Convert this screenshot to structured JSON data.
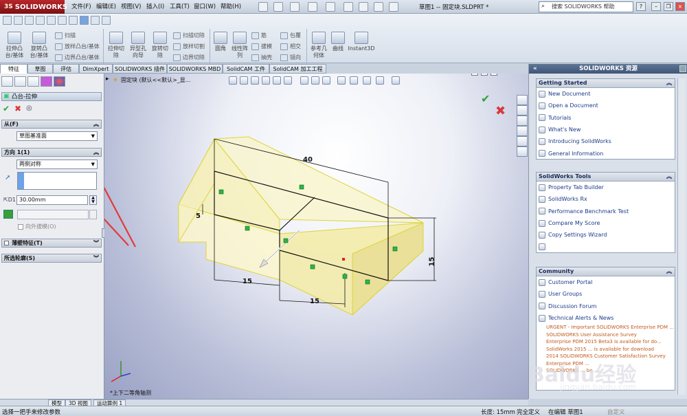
{
  "app": {
    "logo": "SOLIDWORKS",
    "logo_prefix": "3S",
    "title": "草图1 -- 固定块.SLDPRT *"
  },
  "menu": [
    "文件(F)",
    "编辑(E)",
    "视图(V)",
    "插入(I)",
    "工具(T)",
    "窗口(W)",
    "帮助(H)"
  ],
  "help_search": {
    "placeholder": "搜索 SOLIDWORKS 帮助"
  },
  "ribbon": {
    "big": [
      {
        "id": "extrude-boss",
        "label": "拉伸凸台/基体"
      },
      {
        "id": "revolve-boss",
        "label": "旋转凸台/基体"
      },
      {
        "id": "extrude-cut",
        "label": "拉伸切除"
      },
      {
        "id": "hole-wizard",
        "label": "异型孔向导"
      },
      {
        "id": "revolve-cut",
        "label": "旋转切除"
      },
      {
        "id": "fillet",
        "label": "圆角"
      },
      {
        "id": "linear-pattern",
        "label": "线性阵列"
      },
      {
        "id": "ref-geometry",
        "label": "参考几何体"
      },
      {
        "id": "curves",
        "label": "曲线"
      },
      {
        "id": "instant3d",
        "label": "Instant3D"
      }
    ],
    "small": {
      "sweep": "扫描",
      "loft": "放样凸台/基体",
      "boundary": "边界凸台/基体",
      "sweep_cut": "扫描切除",
      "loft_cut": "放样切割",
      "boundary_cut": "边界切除",
      "rib": "筋",
      "draft": "拔模",
      "shell": "抽壳",
      "wrap": "包覆",
      "intersect": "相交",
      "mirror": "镜向"
    }
  },
  "tabs": [
    "特征",
    "草图",
    "评估",
    "DimXpert",
    "SOLIDWORKS 插件",
    "SOLIDWORKS MBD",
    "SolidCAM 工件",
    "SolidCAM 加工工程"
  ],
  "property_manager": {
    "title": "凸台-拉伸",
    "from": {
      "label": "从(F)",
      "value": "草图基准面"
    },
    "direction1": {
      "label": "方向 1(1)",
      "end_condition": "两侧对称",
      "depth": "30.00mm",
      "draft_outward": "向外拔模(O)"
    },
    "thin_feature": "薄壁特征(T)",
    "selected_contours": "所选轮廓(S)"
  },
  "viewport": {
    "tree_path": "固定块  (默认<<默认>_显...",
    "view_name": "*上下二等角轴测",
    "dimensions": {
      "length": "40",
      "height_left": "5",
      "height_right": "15",
      "width_front": "15",
      "width_step": "15"
    }
  },
  "resources": {
    "title": "SOLIDWORKS 资源",
    "getting_started": {
      "title": "Getting Started",
      "items": [
        "New Document",
        "Open a Document",
        "Tutorials",
        "What's New",
        "Introducing SolidWorks",
        "General Information"
      ]
    },
    "tools": {
      "title": "SolidWorks Tools",
      "items": [
        "Property Tab Builder",
        "SolidWorks Rx",
        "Performance Benchmark Test",
        "Compare My Score",
        "Copy Settings Wizard",
        ""
      ]
    },
    "community": {
      "title": "Community",
      "items": [
        "Customer Portal",
        "User Groups",
        "Discussion Forum",
        "Technical Alerts & News"
      ],
      "alerts": [
        "URGENT - Important SOLIDWORKS Enterprise PDM ...",
        "SOLIDWORKS User Assistance Survey",
        "Enterprise PDM 2015 Beta3 is available for do...",
        "SolidWorks 2015 ... is available for download",
        "2014 SOLIDWORKS Customer Satisfaction Survey",
        "Enterprise PDM ...",
        "SOLIDWORKS ... be ..."
      ]
    }
  },
  "bottom_tabs": [
    "模型",
    "3D 视图",
    "运动算例 1"
  ],
  "status": {
    "left": "选择一把手来修改参数",
    "length": "长度: 15mm",
    "state": "完全定义",
    "editing": "在编辑 草图1",
    "custom": "自定义"
  },
  "watermark": {
    "main": "Baidu经验",
    "sub": "jingyan.baidu.com"
  },
  "colors": {
    "accent": "#b8262b",
    "ok": "#2da43a",
    "cancel": "#d63a3a",
    "body_fill": "#f7f2b8",
    "edge": "#e8e040"
  }
}
